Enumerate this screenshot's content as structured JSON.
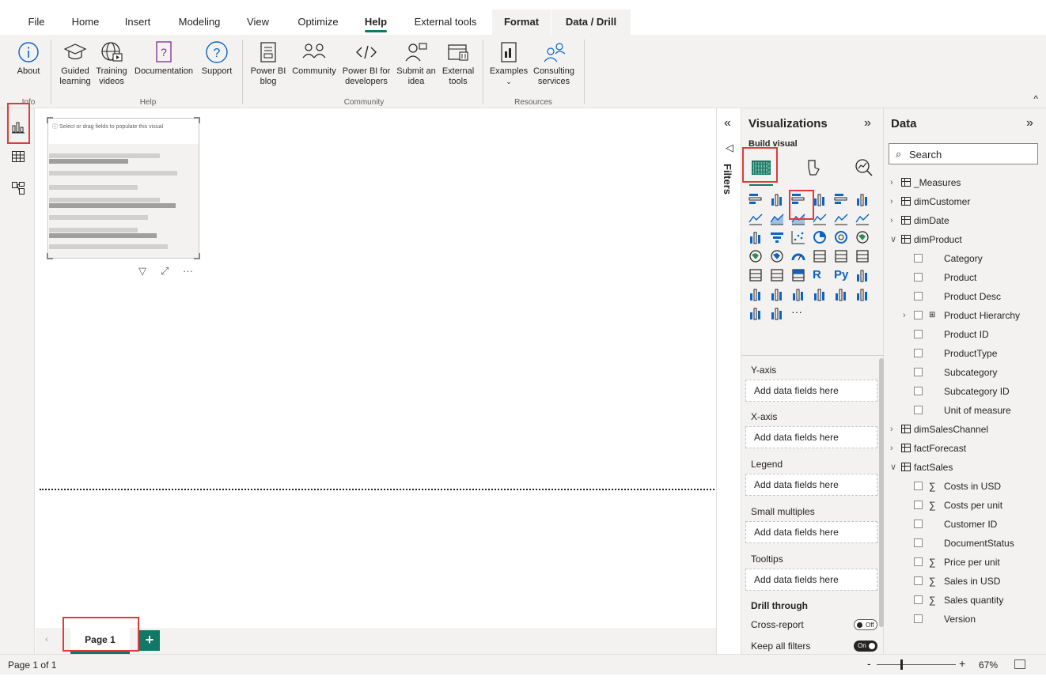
{
  "menu": {
    "tabs": [
      {
        "label": "File"
      },
      {
        "label": "Home"
      },
      {
        "label": "Insert"
      },
      {
        "label": "Modeling"
      },
      {
        "label": "View"
      },
      {
        "label": "Optimize"
      },
      {
        "label": "Help"
      },
      {
        "label": "External tools"
      },
      {
        "label": "Format"
      },
      {
        "label": "Data / Drill"
      }
    ],
    "active_tab": "Help"
  },
  "ribbon": {
    "buttons": [
      {
        "label": "About",
        "icon": "info-icon"
      },
      {
        "label": "Guided learning",
        "icon": "graduation-cap-icon"
      },
      {
        "label": "Training videos",
        "icon": "globe-video-icon"
      },
      {
        "label": "Documentation",
        "icon": "documentation-icon"
      },
      {
        "label": "Support",
        "icon": "question-icon"
      },
      {
        "label": "Power BI blog",
        "icon": "blog-icon"
      },
      {
        "label": "Community",
        "icon": "people-icon"
      },
      {
        "label": "Power BI for developers",
        "icon": "code-icon"
      },
      {
        "label": "Submit an idea",
        "icon": "person-idea-icon"
      },
      {
        "label": "External tools",
        "icon": "external-tools-icon"
      },
      {
        "label": "Examples",
        "icon": "examples-icon"
      },
      {
        "label": "Consulting services",
        "icon": "consulting-icon"
      }
    ],
    "groups": [
      "Info",
      "Help",
      "Community",
      "Resources"
    ]
  },
  "canvas": {
    "visual_hint": "Select or drag fields to populate this visual"
  },
  "page_tabs": {
    "pages": [
      {
        "label": "Page 1"
      }
    ],
    "add_label": "+"
  },
  "status": {
    "page_info": "Page 1 of 1",
    "zoom_minus": "-",
    "zoom_plus": "+",
    "zoom": "67%",
    "zoom_level_percent": 67
  },
  "filters": {
    "label": "Filters"
  },
  "visualizations": {
    "title": "Visualizations",
    "build_label": "Build visual",
    "wells": [
      {
        "label": "Y-axis",
        "placeholder": "Add data fields here"
      },
      {
        "label": "X-axis",
        "placeholder": "Add data fields here"
      },
      {
        "label": "Legend",
        "placeholder": "Add data fields here"
      },
      {
        "label": "Small multiples",
        "placeholder": "Add data fields here"
      },
      {
        "label": "Tooltips",
        "placeholder": "Add data fields here"
      }
    ],
    "drill_through": "Drill through",
    "cross_report": "Cross-report",
    "cross_report_toggle": "Off",
    "keep_all_filters": "Keep all filters",
    "keep_all_filters_toggle": "On",
    "more": "···"
  },
  "data": {
    "title": "Data",
    "search_placeholder": "Search",
    "tables": [
      {
        "name": "_Measures",
        "expanded": false
      },
      {
        "name": "dimCustomer",
        "expanded": false
      },
      {
        "name": "dimDate",
        "expanded": false
      },
      {
        "name": "dimProduct",
        "expanded": true,
        "fields": [
          {
            "name": "Category"
          },
          {
            "name": "Product"
          },
          {
            "name": "Product Desc"
          },
          {
            "name": "Product Hierarchy",
            "hierarchy": true
          },
          {
            "name": "Product ID"
          },
          {
            "name": "ProductType"
          },
          {
            "name": "Subcategory"
          },
          {
            "name": "Subcategory ID"
          },
          {
            "name": "Unit of measure"
          }
        ]
      },
      {
        "name": "dimSalesChannel",
        "expanded": false
      },
      {
        "name": "factForecast",
        "expanded": false
      },
      {
        "name": "factSales",
        "expanded": true,
        "fields": [
          {
            "name": "Costs in USD",
            "sum": true
          },
          {
            "name": "Costs per unit",
            "sum": true
          },
          {
            "name": "Customer ID"
          },
          {
            "name": "DocumentStatus"
          },
          {
            "name": "Price per unit",
            "sum": true
          },
          {
            "name": "Sales in USD",
            "sum": true
          },
          {
            "name": "Sales quantity",
            "sum": true
          },
          {
            "name": "Version"
          }
        ]
      }
    ]
  },
  "colors": {
    "accent": "#117865",
    "highlight": "#e03a3a",
    "pane_bg": "#f3f2f1"
  }
}
